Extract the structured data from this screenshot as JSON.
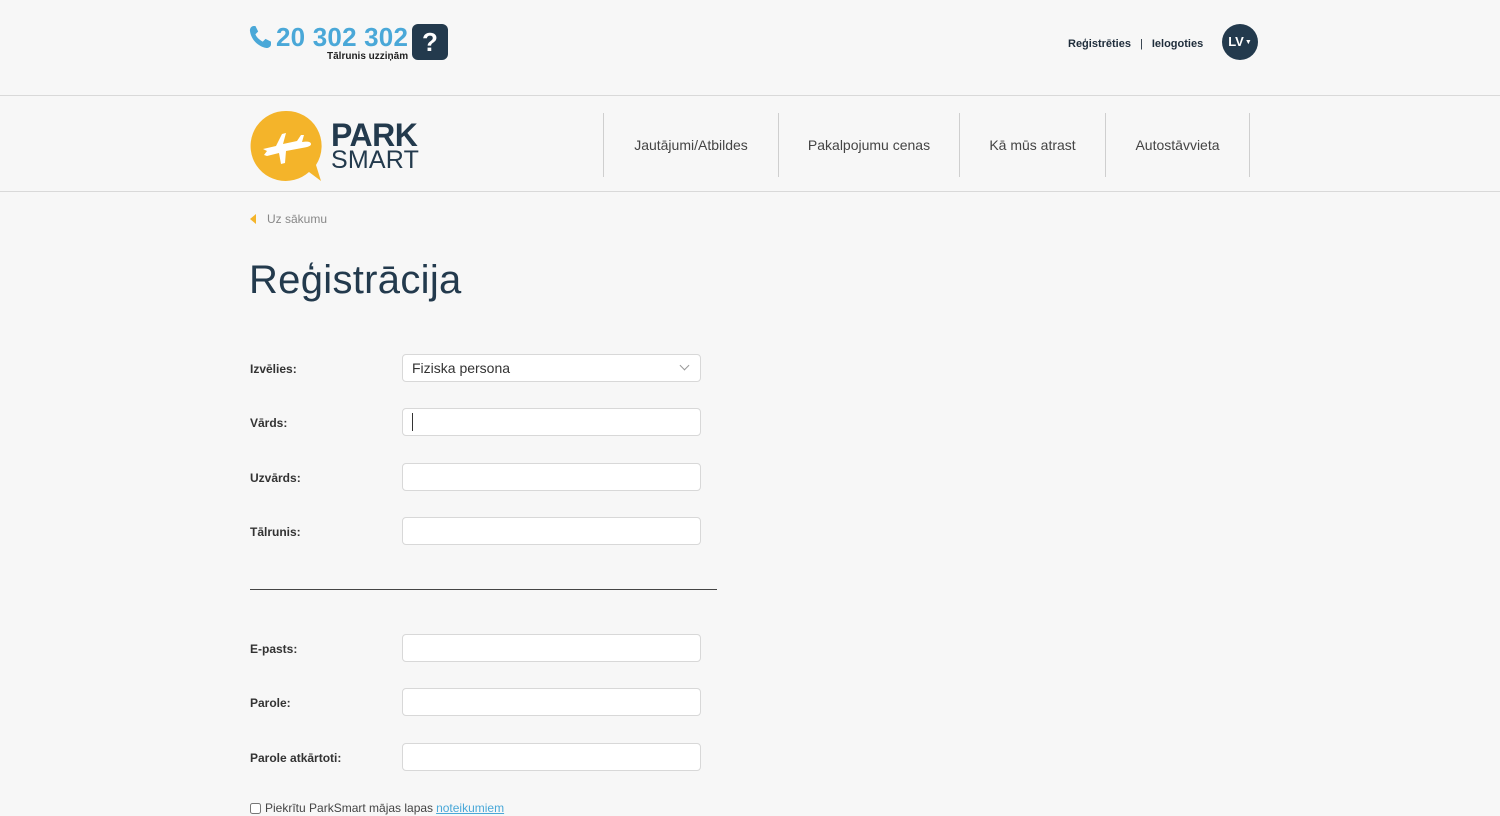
{
  "header": {
    "phone_number": "20 302 302",
    "phone_caption": "Tālrunis uzziņām",
    "help_label": "?",
    "register_link": "Reģistrēties",
    "separator": "|",
    "login_link": "Ielogoties",
    "language": "LV"
  },
  "logo": {
    "line1": "PARK",
    "line2": "SMART"
  },
  "nav": {
    "items": [
      {
        "label": "Jautājumi/Atbildes"
      },
      {
        "label": "Pakalpojumu cenas"
      },
      {
        "label": "Kā mūs atrast"
      },
      {
        "label": "Autostāvvieta"
      }
    ]
  },
  "breadcrumb": "Uz sākumu",
  "title": "Reģistrācija",
  "form": {
    "type_label": "Izvēlies:",
    "type_value": "Fiziska persona",
    "first_name_label": "Vārds:",
    "last_name_label": "Uzvārds:",
    "phone_label": "Tālrunis:",
    "email_label": "E-pasts:",
    "password_label": "Parole:",
    "password_repeat_label": "Parole atkārtoti:",
    "terms_text": "Piekrītu ParkSmart mājas lapas",
    "terms_link": "noteikumiem"
  },
  "colors": {
    "accent_blue": "#4aa8d8",
    "navy": "#233a4d",
    "logo_yellow": "#f4b42a"
  }
}
